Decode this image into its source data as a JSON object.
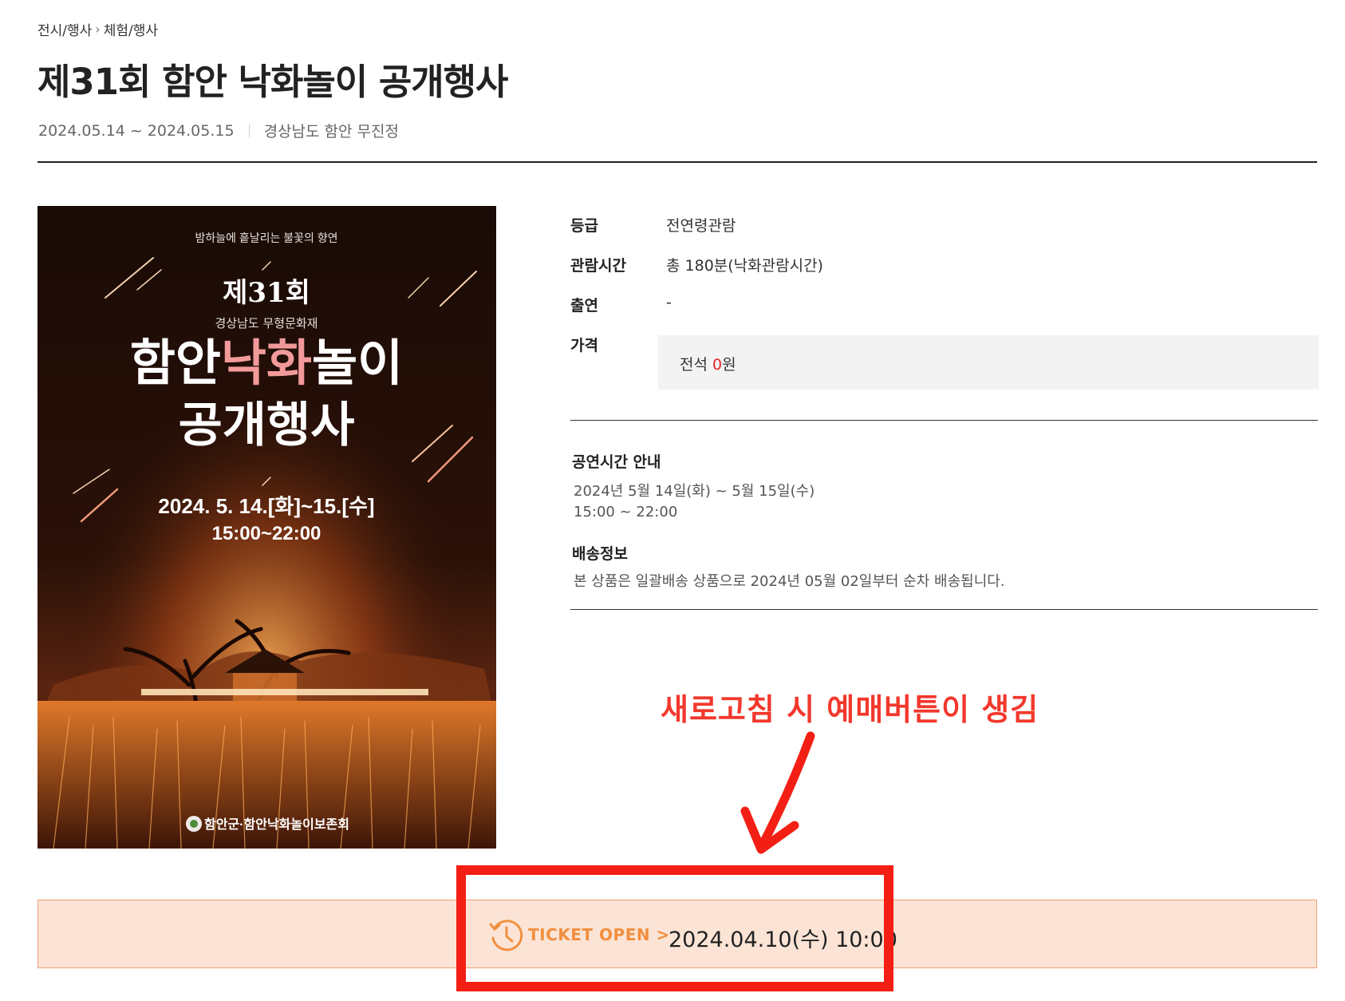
{
  "breadcrumb": {
    "level1": "전시/행사",
    "level2": "체험/행사"
  },
  "page_title": "제31회 함안 낙화놀이 공개행사",
  "meta": {
    "period": "2024.05.14 ~ 2024.05.15",
    "venue": "경상남도 함안 무진정"
  },
  "poster": {
    "tagline": "밤하늘에 흩날리는 불꽃의 향연",
    "edition": "제31회",
    "heritage": "경상남도 무형문화재",
    "title_line1_a": "함안",
    "title_line1_b": "낙화",
    "title_line1_c": "놀이",
    "title_line2": "공개행사",
    "dates": "2024. 5. 14.[화]~15.[수]",
    "hours": "15:00~22:00",
    "organizer": "함안군·함안낙화놀이보존회"
  },
  "info": {
    "grade_label": "등급",
    "grade_value": "전연령관람",
    "runtime_label": "관람시간",
    "runtime_value": "총 180분(낙화관람시간)",
    "cast_label": "출연",
    "cast_value": "-",
    "price_label": "가격",
    "price_prefix": "전석 ",
    "price_amount": "0",
    "price_suffix": "원"
  },
  "schedule": {
    "title": "공연시간 안내",
    "line1": "2024년 5월 14일(화) ~ 5월 15일(수)",
    "line2": "15:00 ~ 22:00"
  },
  "delivery": {
    "title": "배송정보",
    "text": "본 상품은 일괄배송 상품으로 2024년 05월 02일부터 순차 배송됩니다."
  },
  "ticket_open": {
    "label": "TICKET OPEN >",
    "datetime": "2024.04.10(수) 10:00",
    "icon": "clock-history-icon"
  },
  "annotation": {
    "text": "새로고침 시 예매버튼이 생김",
    "color": "#f2382c"
  },
  "colors": {
    "accent_orange": "#f28e3f",
    "ticket_bg": "#fbe4d5",
    "annotation_red": "#f31f14",
    "price_red": "#e0262b"
  }
}
